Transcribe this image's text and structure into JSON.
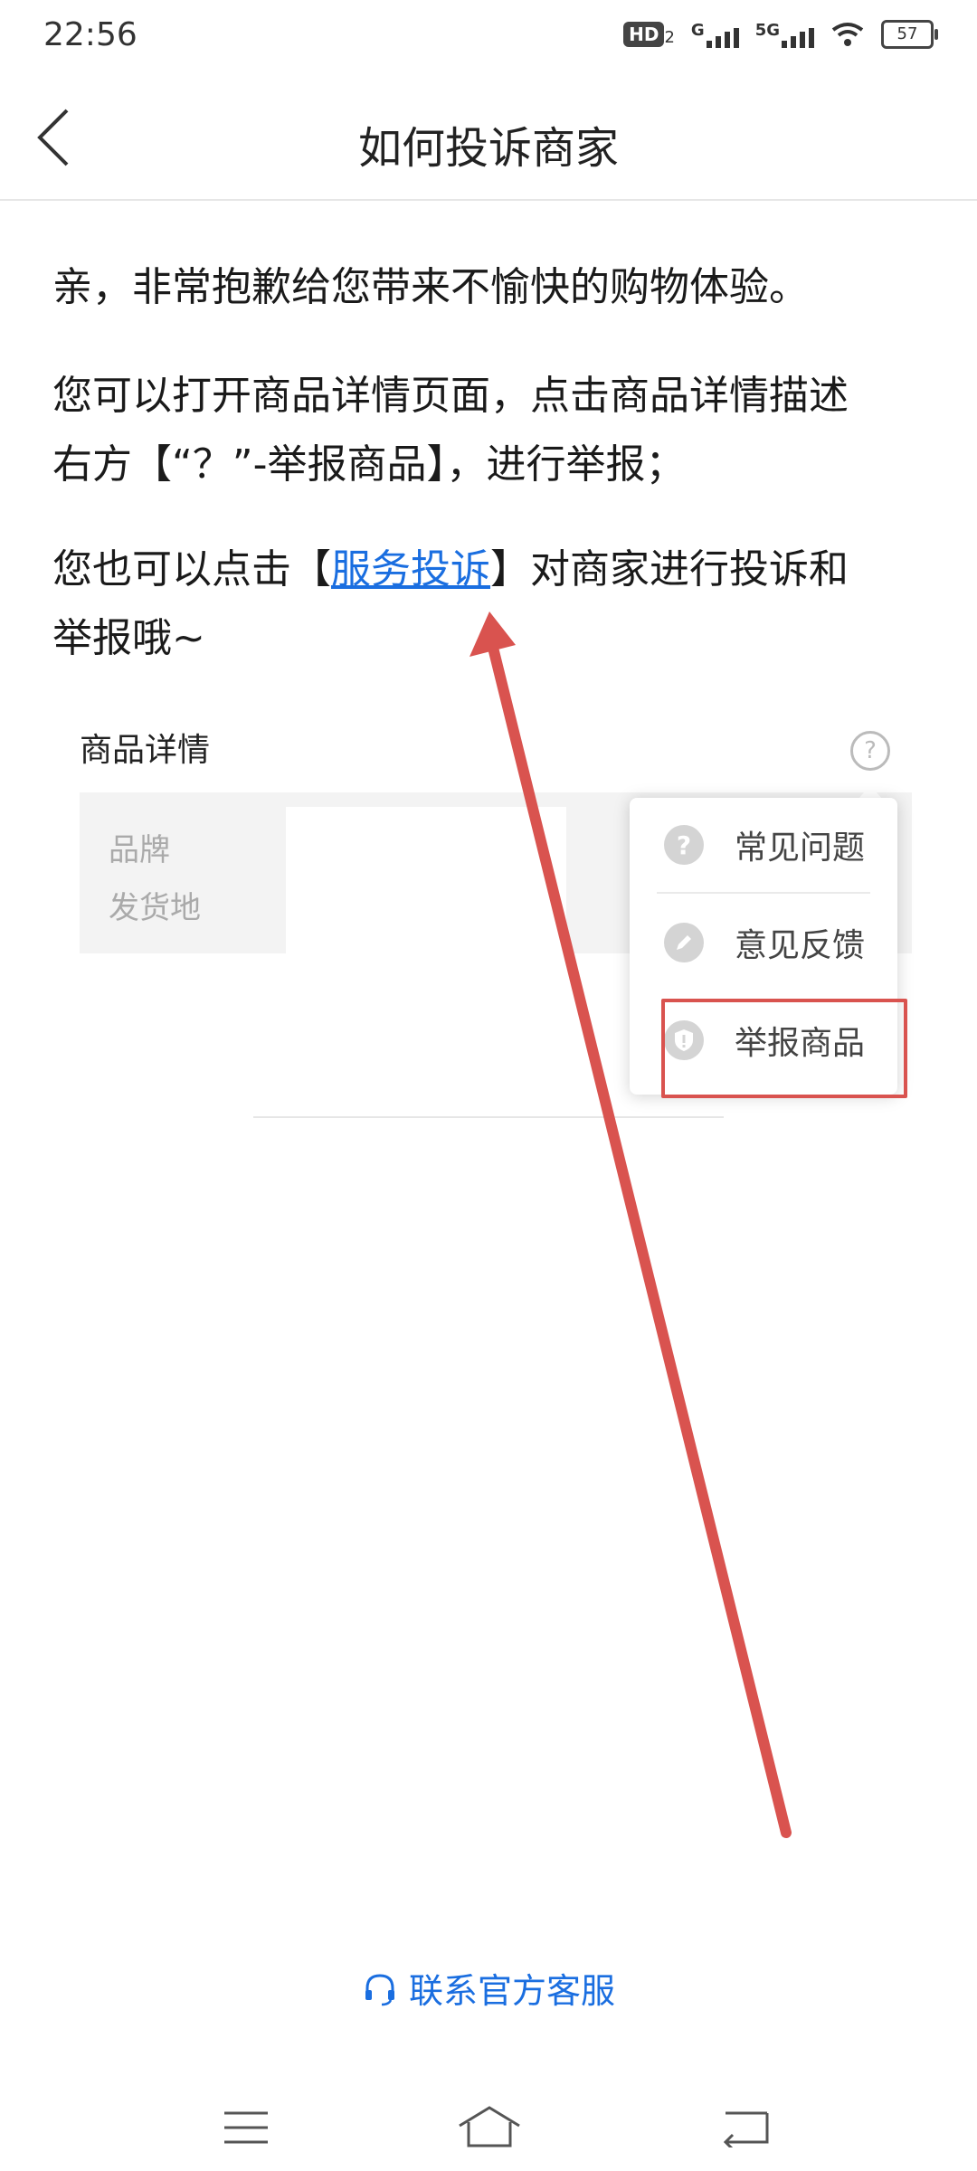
{
  "status_bar": {
    "time": "22:56",
    "hd_label": "HD",
    "hd_sub": "2",
    "signal1_label": "G",
    "signal2_label": "5G",
    "battery": "57"
  },
  "nav": {
    "title": "如何投诉商家"
  },
  "article": {
    "p1": "亲，非常抱歉给您带来不愉快的购物体验。",
    "p2_line1": "您可以打开商品详情页面，点击商品详情描述",
    "p2_line2": "右方【“？”-举报商品】，进行举报；",
    "p3_prefix": "您也可以点击【",
    "p3_link": "服务投诉",
    "p3_suffix": "】对商家进行投诉和",
    "p3_line2": "举报哦~"
  },
  "illustration": {
    "detail_title": "商品详情",
    "help_glyph": "?",
    "label_brand": "品牌",
    "label_ship_from": "发货地",
    "menu": [
      {
        "icon": "question-icon",
        "label": "常见问题"
      },
      {
        "icon": "edit-icon",
        "label": "意见反馈"
      },
      {
        "icon": "shield-icon",
        "label": "举报商品"
      }
    ]
  },
  "footer": {
    "contact_label": "联系官方客服"
  },
  "colors": {
    "link": "#1a6ee0",
    "annotation": "#d9534f"
  }
}
